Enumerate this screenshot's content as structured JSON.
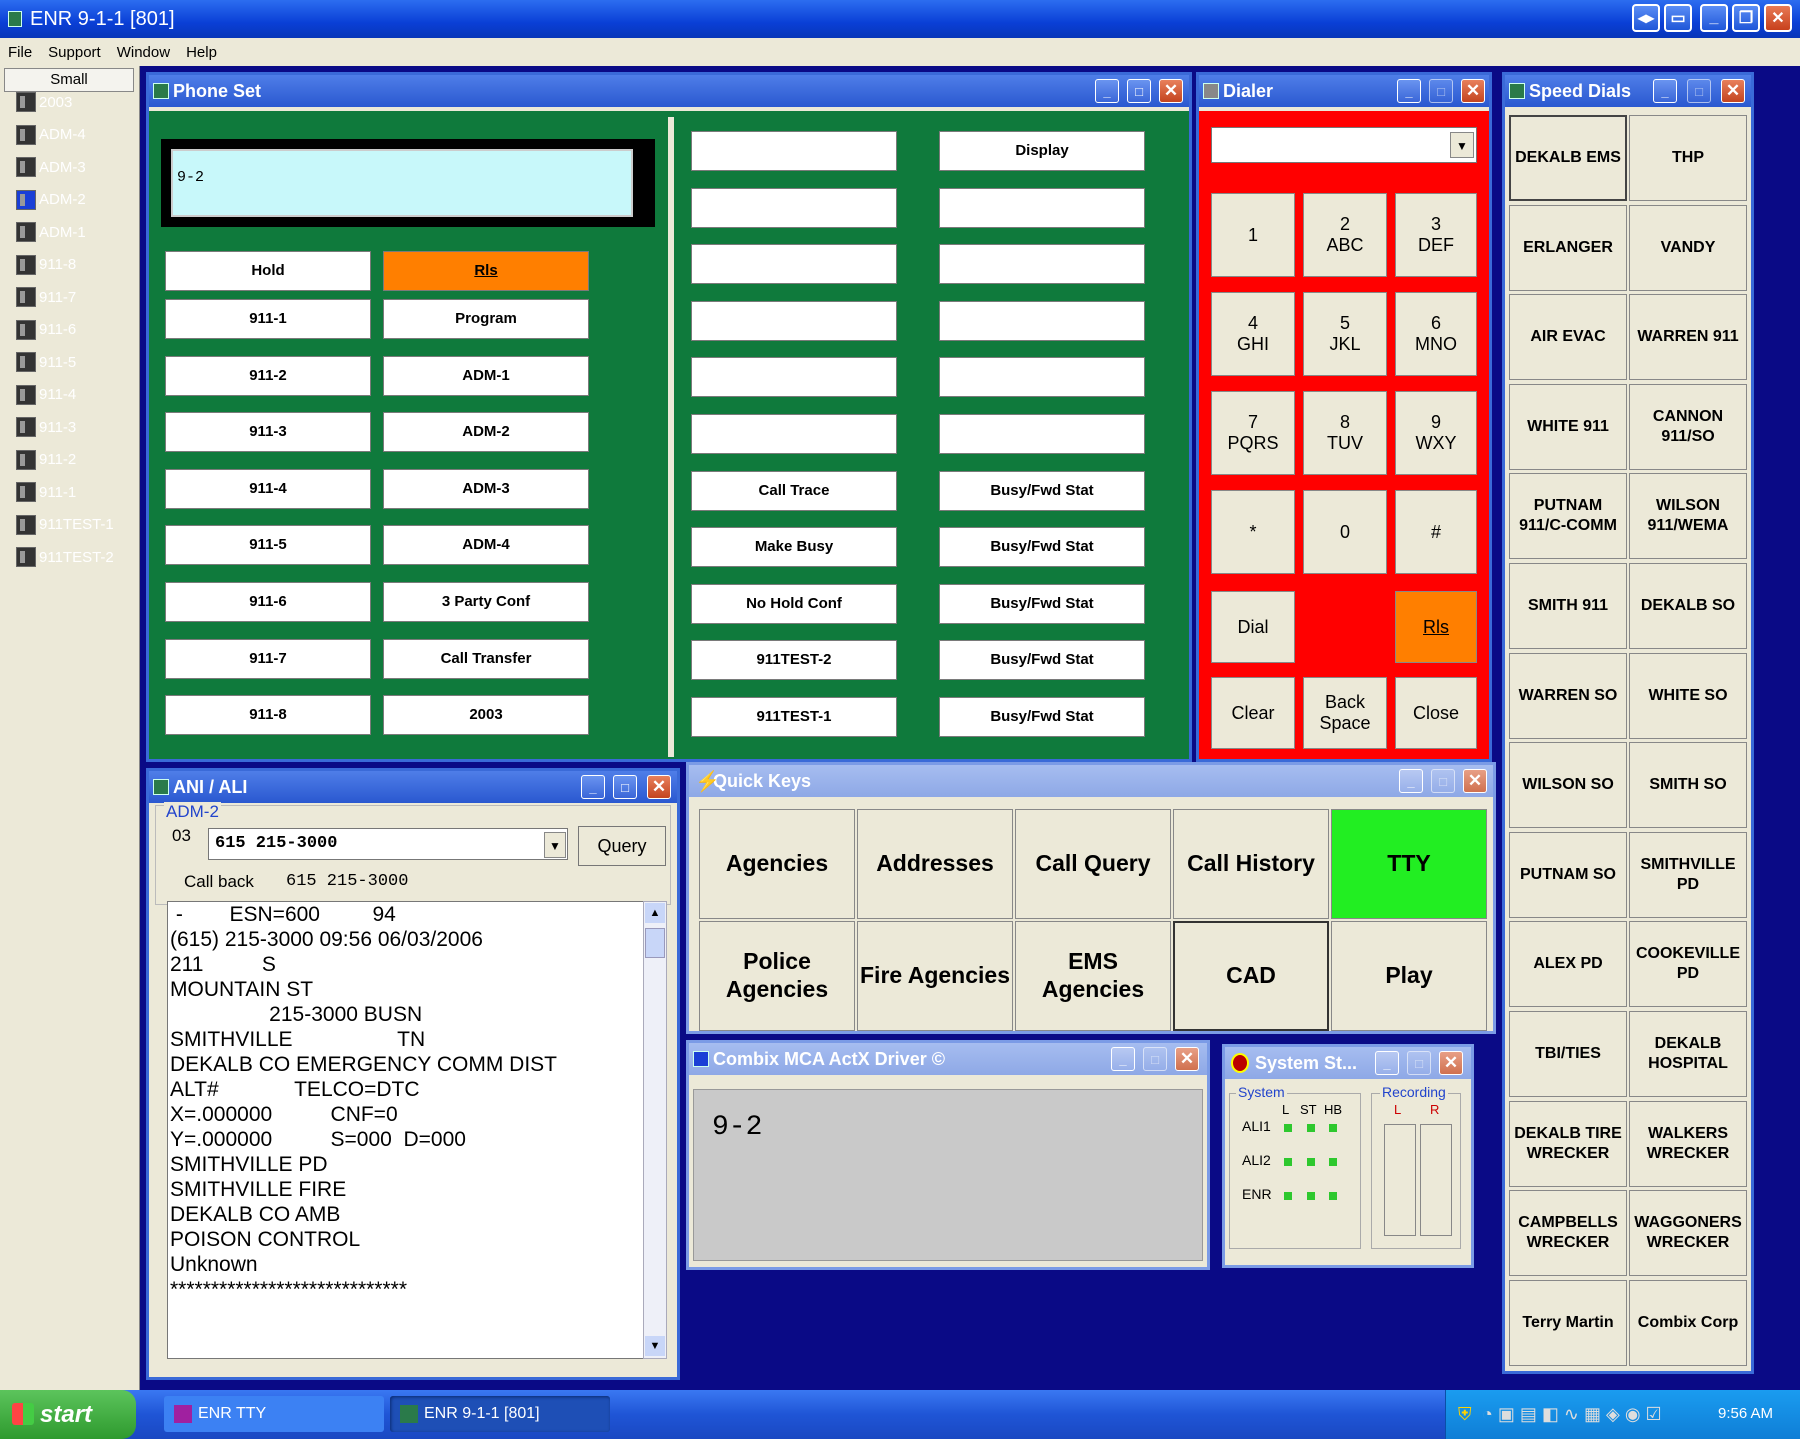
{
  "app": {
    "title": "ENR 9-1-1 [801]"
  },
  "menu": [
    "File",
    "Support",
    "Window",
    "Help"
  ],
  "sidebar": {
    "header": "Small",
    "items": [
      "2003",
      "ADM-4",
      "ADM-3",
      "ADM-2",
      "ADM-1",
      "911-8",
      "911-7",
      "911-6",
      "911-5",
      "911-4",
      "911-3",
      "911-2",
      "911-1",
      "911TEST-1",
      "911TEST-2"
    ],
    "selected": "ADM-2"
  },
  "phone_set": {
    "title": "Phone Set",
    "display": "9-2",
    "left_buttons": [
      [
        "Hold",
        "Rls"
      ],
      [
        "911-1",
        "Program"
      ],
      [
        "911-2",
        "ADM-1"
      ],
      [
        "911-3",
        "ADM-2"
      ],
      [
        "911-4",
        "ADM-3"
      ],
      [
        "911-5",
        "ADM-4"
      ],
      [
        "911-6",
        "3 Party Conf"
      ],
      [
        "911-7",
        "Call Transfer"
      ],
      [
        "911-8",
        "2003"
      ]
    ],
    "right_buttons": [
      [
        "",
        "Display"
      ],
      [
        "",
        ""
      ],
      [
        "",
        ""
      ],
      [
        "",
        ""
      ],
      [
        "",
        ""
      ],
      [
        "",
        ""
      ],
      [
        "Call Trace",
        "Busy/Fwd Stat"
      ],
      [
        "Make Busy",
        "Busy/Fwd Stat"
      ],
      [
        "No Hold Conf",
        "Busy/Fwd Stat"
      ],
      [
        "911TEST-2",
        "Busy/Fwd Stat"
      ],
      [
        "911TEST-1",
        "Busy/Fwd Stat"
      ]
    ]
  },
  "dialer": {
    "title": "Dialer",
    "keys": [
      "1",
      "2\nABC",
      "3\nDEF",
      "4\nGHI",
      "5\nJKL",
      "6\nMNO",
      "7\nPQRS",
      "8\nTUV",
      "9\nWXY",
      "*",
      "0",
      "#"
    ],
    "dial": "Dial",
    "rls": "Rls",
    "clear": "Clear",
    "backspace": "Back\nSpace",
    "close": "Close"
  },
  "speed_dials": {
    "title": "Speed Dials",
    "items": [
      [
        "DEKALB EMS",
        "THP"
      ],
      [
        "ERLANGER",
        "VANDY"
      ],
      [
        "AIR EVAC",
        "WARREN 911"
      ],
      [
        "WHITE 911",
        "CANNON\n911/SO"
      ],
      [
        "PUTNAM\n911/C-COMM",
        "WILSON\n911/WEMA"
      ],
      [
        "SMITH 911",
        "DEKALB SO"
      ],
      [
        "WARREN SO",
        "WHITE SO"
      ],
      [
        "WILSON SO",
        "SMITH SO"
      ],
      [
        "PUTNAM SO",
        "SMITHVILLE\nPD"
      ],
      [
        "ALEX PD",
        "COOKEVILLE\nPD"
      ],
      [
        "TBI/TIES",
        "DEKALB\nHOSPITAL"
      ],
      [
        "DEKALB TIRE\nWRECKER",
        "WALKERS\nWRECKER"
      ],
      [
        "CAMPBELLS\nWRECKER",
        "WAGGONERS\nWRECKER"
      ],
      [
        "Terry Martin",
        "Combix Corp"
      ]
    ]
  },
  "ani_ali": {
    "title": "ANI / ALI",
    "group": "ADM-2",
    "line": "03",
    "number": "615 215-3000",
    "query": "Query",
    "callback_label": "Call back",
    "callback_value": "615 215-3000",
    "lines": [
      " -        ESN=600         94",
      "(615) 215-3000 09:56 06/03/2006",
      "211          S",
      "MOUNTAIN ST",
      "                 215-3000 BUSN",
      "SMITHVILLE                  TN",
      "",
      "DEKALB CO EMERGENCY COMM DIST",
      "ALT#             TELCO=DTC",
      "X=.000000          CNF=0",
      "Y=.000000          S=000  D=000",
      "",
      "SMITHVILLE PD",
      "SMITHVILLE FIRE",
      "DEKALB CO AMB",
      "POISON CONTROL",
      "Unknown",
      "*****************************"
    ]
  },
  "quick_keys": {
    "title": "Quick Keys",
    "row1": [
      "Agencies",
      "Addresses",
      "Call Query",
      "Call History",
      "TTY"
    ],
    "row2": [
      "Police\nAgencies",
      "Fire Agencies",
      "EMS\nAgencies",
      "CAD",
      "Play"
    ]
  },
  "combix": {
    "title": "Combix MCA ActX Driver ©",
    "display": "9-2"
  },
  "system_status": {
    "title": "System St...",
    "system_label": "System",
    "cols": [
      "L",
      "ST",
      "HB"
    ],
    "rows": [
      "ALI1",
      "ALI2",
      "ENR"
    ],
    "recording_label": "Recording",
    "rec_cols": [
      "L",
      "R"
    ]
  },
  "taskbar": {
    "start": "start",
    "tasks": [
      "ENR TTY",
      "ENR 9-1-1 [801]"
    ],
    "clock": "9:56 AM"
  },
  "colors": {
    "phone_green": "#0f7a3c",
    "dialer_red": "#ff0000",
    "rls_orange": "#ff7f00",
    "tty_green": "#22ee22",
    "desktop": "#0a0a86"
  }
}
